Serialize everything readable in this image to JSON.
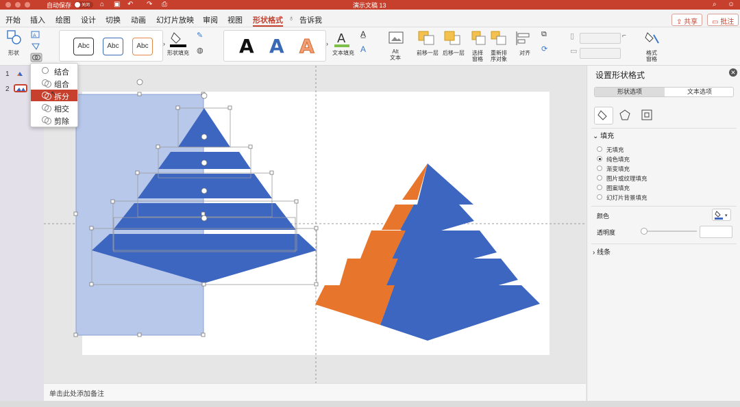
{
  "window": {
    "title": "演示文稿 13",
    "autosave_label": "自动保存",
    "autosave_state": "关闭"
  },
  "tabs": [
    {
      "label": "开始"
    },
    {
      "label": "插入"
    },
    {
      "label": "绘图"
    },
    {
      "label": "设计"
    },
    {
      "label": "切换"
    },
    {
      "label": "动画"
    },
    {
      "label": "幻灯片放映"
    },
    {
      "label": "审阅"
    },
    {
      "label": "视图"
    },
    {
      "label": "形状格式"
    },
    {
      "label": "告诉我"
    }
  ],
  "active_tab": "形状格式",
  "actions": {
    "share": "共享",
    "comments": "批注"
  },
  "ribbon": {
    "shape_label": "形状",
    "style_samples": [
      "Abc",
      "Abc",
      "Abc"
    ],
    "shape_fill_label": "形状填充",
    "wordart_samples": [
      "A",
      "A",
      "A"
    ],
    "text_fill_label": "文本填充",
    "alt_text_label": "Alt\n文本",
    "bring_forward_label": "前移一层",
    "send_backward_label": "后移一层",
    "selection_pane_label": "选择\n窗格",
    "rearrange_label": "重新排\n序对象",
    "align_label": "对齐",
    "format_pane_label": "格式\n窗格"
  },
  "slides": [
    {
      "number": "1"
    },
    {
      "number": "2"
    }
  ],
  "merge_menu": {
    "items": [
      "结合",
      "组合",
      "拆分",
      "相交",
      "剪除"
    ],
    "selected": "拆分"
  },
  "notes_placeholder": "单击此处添加备注",
  "format_pane": {
    "title": "设置形状格式",
    "tabs": [
      "形状选项",
      "文本选项"
    ],
    "fill_section": "填充",
    "fill_options": [
      "无填充",
      "纯色填充",
      "渐变填充",
      "图片或纹理填充",
      "图案填充",
      "幻灯片背景填充"
    ],
    "fill_selected": "纯色填充",
    "color_label": "颜色",
    "transparency_label": "透明度",
    "line_section": "线条"
  },
  "colors": {
    "accent": "#c7402d",
    "pyramid_blue": "#3d66c1",
    "pyramid_orange": "#e8752c",
    "selection_fill": "#b8c8ea"
  }
}
